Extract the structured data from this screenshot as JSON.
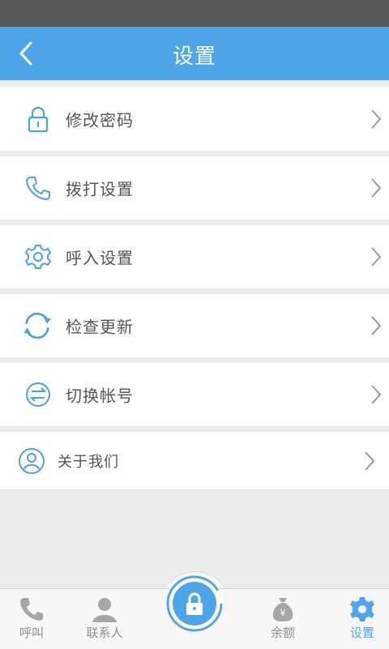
{
  "header": {
    "title": "设置"
  },
  "settings": {
    "items": [
      {
        "label": "修改密码",
        "icon": "lock-icon"
      },
      {
        "label": "拨打设置",
        "icon": "phone-icon"
      },
      {
        "label": "呼入设置",
        "icon": "gear-icon"
      },
      {
        "label": "检查更新",
        "icon": "refresh-icon"
      },
      {
        "label": "切换帐号",
        "icon": "switch-icon"
      },
      {
        "label": "关于我们",
        "icon": "user-icon"
      }
    ]
  },
  "tabbar": {
    "tabs": [
      {
        "label": "呼叫",
        "icon": "phone-icon",
        "active": false
      },
      {
        "label": "联系人",
        "icon": "contact-icon",
        "active": false
      },
      {
        "label": "",
        "icon": "lock-icon",
        "active": false
      },
      {
        "label": "余额",
        "icon": "money-bag-icon",
        "active": false
      },
      {
        "label": "设置",
        "icon": "gear-icon",
        "active": true
      }
    ]
  },
  "colors": {
    "accent": "#4ea6e8",
    "icon_blue": "#4aa3e0",
    "tab_gray": "#a6a6a6",
    "background": "#ebebeb"
  }
}
